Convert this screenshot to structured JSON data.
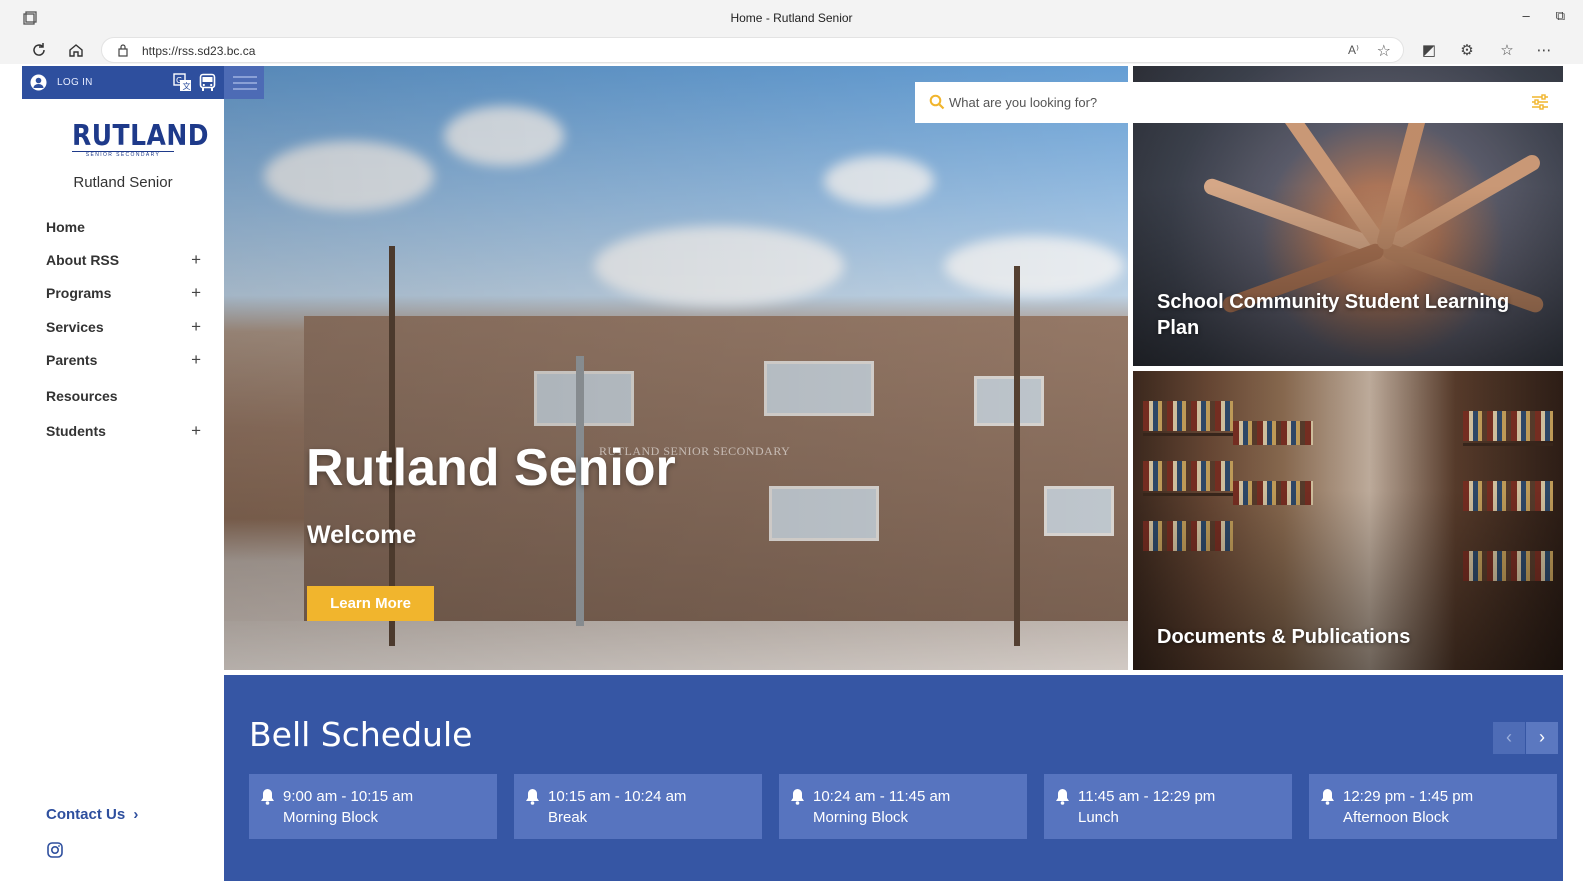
{
  "browser": {
    "tab_title": "Home - Rutland Senior",
    "url": "https://rss.sd23.bc.ca",
    "read_aloud": "A⁾",
    "window_controls": [
      "–",
      "⧉"
    ]
  },
  "login": {
    "label": "LOG IN"
  },
  "logo": {
    "main": "RUTLAND",
    "sub": "SENIOR SECONDARY"
  },
  "site_name": "Rutland Senior",
  "nav": [
    {
      "label": "Home",
      "expandable": false
    },
    {
      "label": "About RSS",
      "expandable": true
    },
    {
      "label": "Programs",
      "expandable": true
    },
    {
      "label": "Services",
      "expandable": true
    },
    {
      "label": "Parents",
      "expandable": true
    },
    {
      "label": "Resources",
      "expandable": false
    },
    {
      "label": "Students",
      "expandable": true
    }
  ],
  "nav_expand_glyph": "+",
  "contact": {
    "label": "Contact Us",
    "chevron": "›"
  },
  "hero": {
    "title": "Rutland Senior",
    "subtitle": "Welcome",
    "button": "Learn More",
    "sign": "RUTLAND SENIOR SECONDARY"
  },
  "search": {
    "placeholder": "What are you looking for?"
  },
  "tiles": [
    {
      "label": "School Community Student Learning Plan"
    },
    {
      "label": "Documents & Publications"
    }
  ],
  "bell_schedule": {
    "title": "Bell Schedule",
    "prev": "‹",
    "next": "›",
    "entries": [
      {
        "time": "9:00 am - 10:15 am",
        "block": "Morning Block"
      },
      {
        "time": "10:15 am - 10:24 am",
        "block": "Break"
      },
      {
        "time": "10:24 am - 11:45 am",
        "block": "Morning Block"
      },
      {
        "time": "11:45 am - 12:29 pm",
        "block": "Lunch"
      },
      {
        "time": "12:29 pm - 1:45 pm",
        "block": "Afternoon Block"
      }
    ]
  },
  "colors": {
    "brand_blue": "#2e4f9e",
    "bell_bg": "#3656a4",
    "bell_card": "#5774bf",
    "accent_yellow": "#f1b52d"
  },
  "icons": [
    "user-icon",
    "translate-icon",
    "bus-icon",
    "menu-icon",
    "search-icon",
    "filter-icon",
    "bell-icon",
    "instagram-icon",
    "plus-icon",
    "chevron-right-icon"
  ]
}
